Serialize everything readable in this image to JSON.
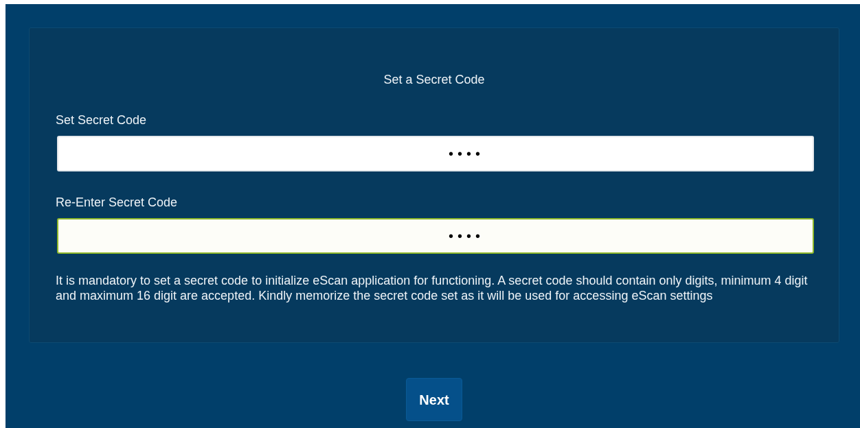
{
  "card": {
    "title": "Set a Secret Code",
    "fields": [
      {
        "label": "Set Secret Code",
        "value": "••••",
        "focused": false
      },
      {
        "label": "Re-Enter Secret Code",
        "value": "••••",
        "focused": true
      }
    ],
    "help_text": "It is mandatory to set a secret code to initialize eScan application for functioning. A secret code should contain only digits, minimum 4 digit and maximum 16 digit are accepted. Kindly memorize the secret code set as it will be used for accessing eScan settings"
  },
  "buttons": [
    {
      "label": "Next"
    }
  ]
}
